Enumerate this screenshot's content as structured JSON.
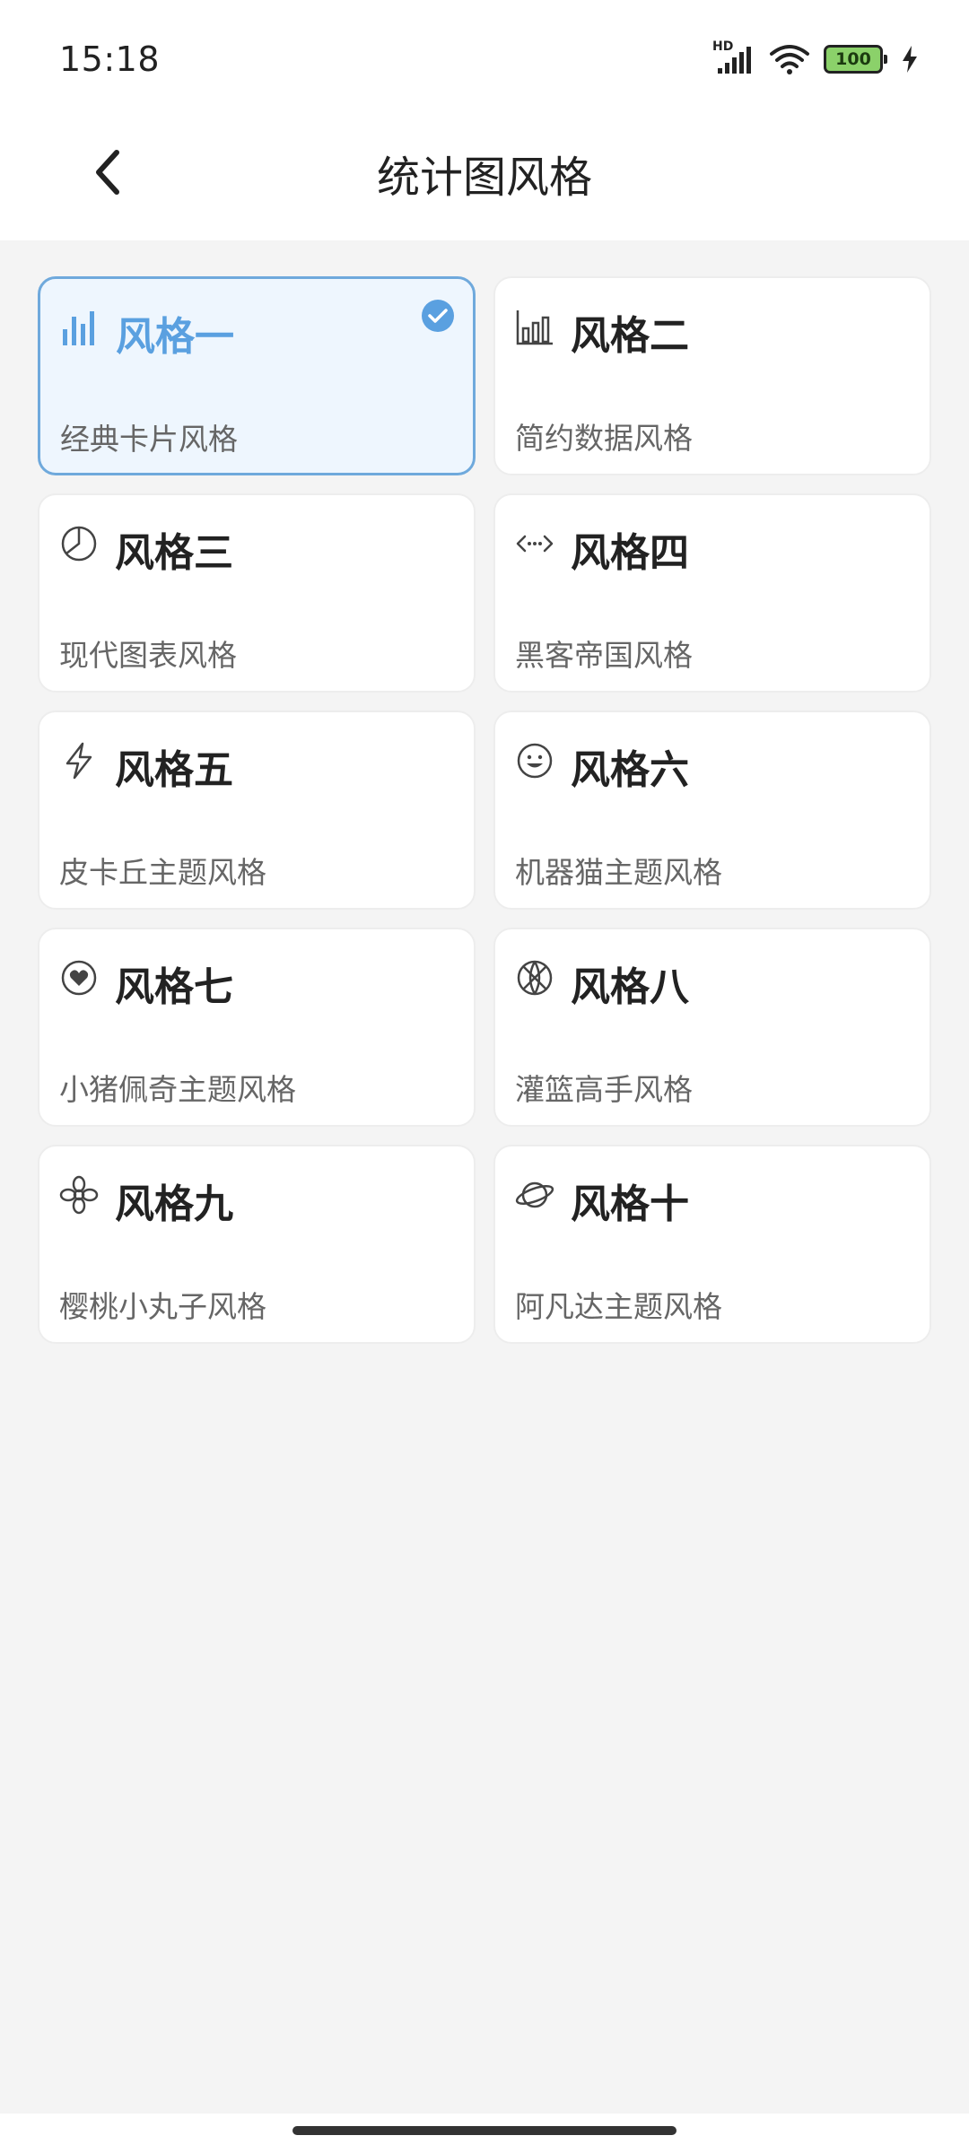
{
  "status_bar": {
    "time": "15:18",
    "network_label": "HD",
    "battery_level": "100"
  },
  "header": {
    "title": "统计图风格"
  },
  "styles": [
    {
      "title": "风格一",
      "description": "经典卡片风格",
      "icon": "bar-chart-icon",
      "selected": true
    },
    {
      "title": "风格二",
      "description": "简约数据风格",
      "icon": "bar-outline-icon",
      "selected": false
    },
    {
      "title": "风格三",
      "description": "现代图表风格",
      "icon": "pie-chart-icon",
      "selected": false
    },
    {
      "title": "风格四",
      "description": "黑客帝国风格",
      "icon": "code-arrows-icon",
      "selected": false
    },
    {
      "title": "风格五",
      "description": "皮卡丘主题风格",
      "icon": "lightning-icon",
      "selected": false
    },
    {
      "title": "风格六",
      "description": "机器猫主题风格",
      "icon": "smiley-icon",
      "selected": false
    },
    {
      "title": "风格七",
      "description": "小猪佩奇主题风格",
      "icon": "heart-circle-icon",
      "selected": false
    },
    {
      "title": "风格八",
      "description": "灌篮高手风格",
      "icon": "basketball-icon",
      "selected": false
    },
    {
      "title": "风格九",
      "description": "樱桃小丸子风格",
      "icon": "flower-icon",
      "selected": false
    },
    {
      "title": "风格十",
      "description": "阿凡达主题风格",
      "icon": "planet-icon",
      "selected": false
    }
  ],
  "colors": {
    "accent": "#5aa0e0",
    "selected_bg": "#eef6fe",
    "page_bg": "#f4f4f4"
  }
}
